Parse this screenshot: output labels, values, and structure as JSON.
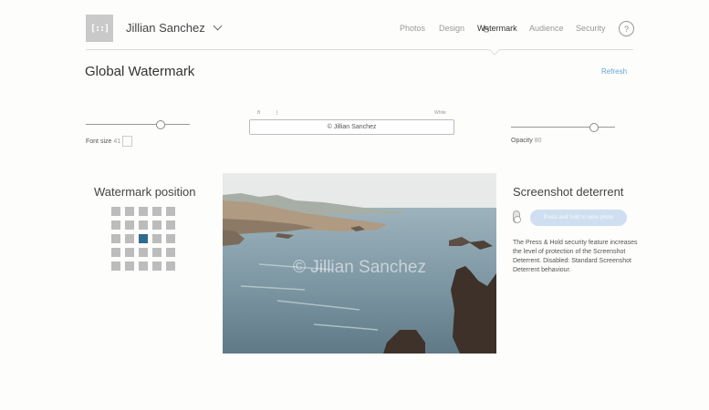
{
  "header": {
    "logo_text": "[::]",
    "user_name": "Jillian Sanchez",
    "nav": [
      {
        "label": "Photos",
        "active": false
      },
      {
        "label": "Design",
        "active": false
      },
      {
        "label": "Watermark",
        "active": true
      },
      {
        "label": "Audience",
        "active": false
      },
      {
        "label": "Security",
        "active": false
      }
    ],
    "help_label": "?"
  },
  "page": {
    "title": "Global Watermark",
    "refresh_label": "Refresh"
  },
  "controls": {
    "font_size": {
      "label": "Font size",
      "value": "41",
      "fraction": 0.72
    },
    "opacity": {
      "label": "Opacity",
      "value": "80",
      "fraction": 0.8
    },
    "text_color": {
      "start_label": "B",
      "end_label": "White",
      "fraction": 0.1
    },
    "watermark_text": "© Jillian Sanchez"
  },
  "watermark_position": {
    "title": "Watermark position",
    "rows": 5,
    "cols": 5,
    "selected": [
      2,
      2
    ]
  },
  "preview": {
    "overlay_text": "© Jillian Sanchez"
  },
  "screenshot_deterrent": {
    "title": "Screenshot deterrent",
    "button_label": "Press and hold to view photo",
    "description": "The Press & Hold security feature increases the level of protection of the Screenshot Deterrent. Disabled: Standard Screenshot Deterrent behaviour."
  },
  "colors": {
    "accent_link": "#6aa1d6",
    "grid_selected": "#2f6b8e",
    "grid_cell": "#bcbcbc",
    "button_disabled": "#cfdff1"
  }
}
